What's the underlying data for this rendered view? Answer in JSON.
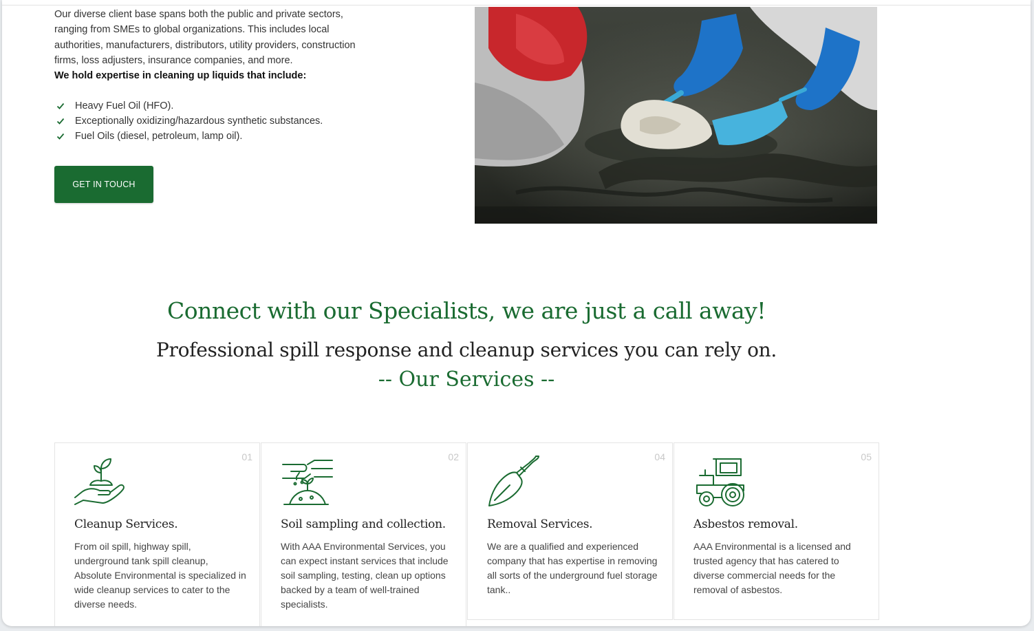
{
  "intro": {
    "lines": [
      "Our diverse client base spans both the public and private sectors,",
      "ranging from SMEs to global organizations. This includes local",
      "authorities, manufacturers, distributors, utility providers, construction",
      "firms, loss adjusters, insurance companies, and more."
    ],
    "expertise_heading": "We hold expertise in cleaning up liquids that include:",
    "liquids": [
      "Heavy Fuel Oil (HFO).",
      "Exceptionally oxidizing/hazardous synthetic substances.",
      "Fuel Oils (diesel, petroleum, lamp oil)."
    ],
    "cta_label": "GET IN TOUCH"
  },
  "headings": {
    "connect": "Connect with our Specialists, we are just a call away!",
    "subtitle": "Professional spill response and cleanup services you can rely on.",
    "services": "-- Our Services --"
  },
  "services": [
    {
      "number": "01",
      "icon": "hand-sprout-icon",
      "title": "Cleanup Services.",
      "description": "From oil spill, highway spill, underground tank spill cleanup, Absolute Environmental is specialized in wide cleanup services to cater to the diverse needs."
    },
    {
      "number": "02",
      "icon": "soil-sampling-icon",
      "title": "Soil sampling and collection.",
      "description": "With AAA Environmental Services, you can expect instant services that include soil sampling, testing, clean up options backed by a team of well-trained specialists."
    },
    {
      "number": "04",
      "icon": "trowel-icon",
      "title": "Removal Services.",
      "description": "We are a qualified and experienced company that has expertise in removing all sorts of the underground fuel storage tank.."
    },
    {
      "number": "05",
      "icon": "tractor-icon",
      "title": "Asbestos removal.",
      "description": "AAA Environmental is a licensed and trusted agency that has catered to diverse commercial needs for the removal of asbestos."
    }
  ],
  "colors": {
    "brand_green": "#1a6b31",
    "text": "#333333",
    "card_border": "#e4e4e4"
  }
}
